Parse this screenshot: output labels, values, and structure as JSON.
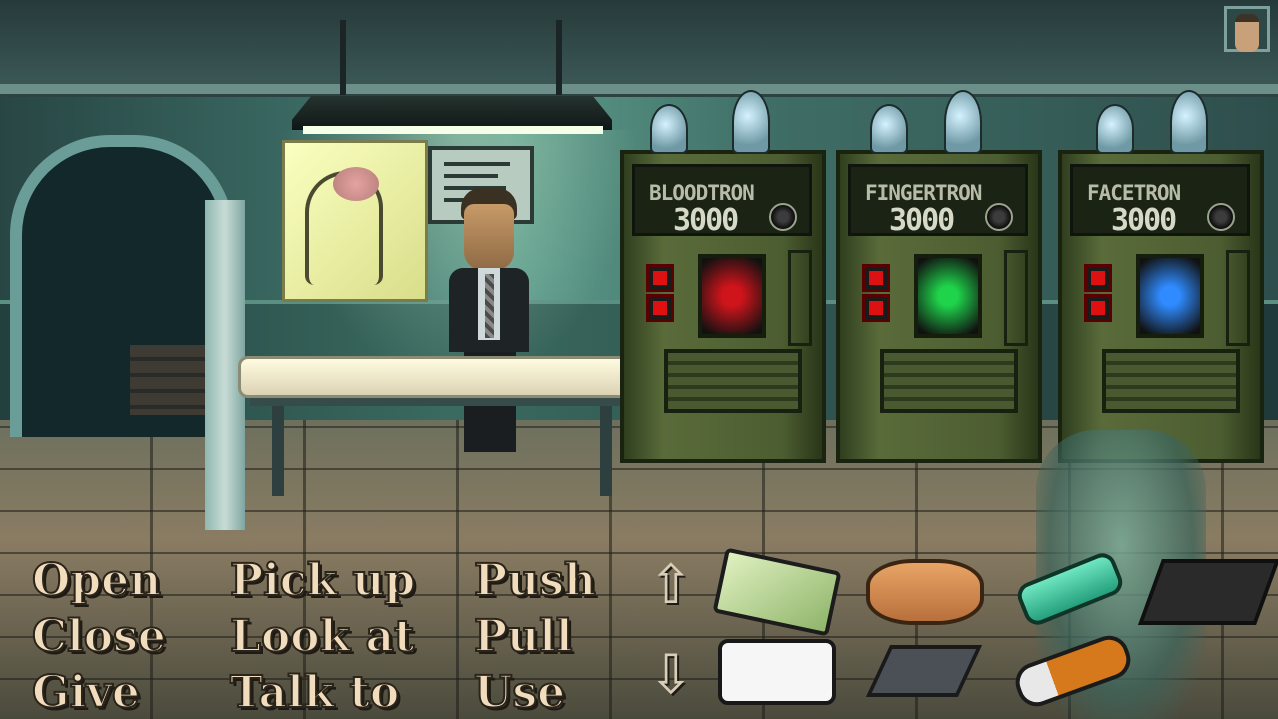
{
  "scene": {
    "machines": [
      {
        "name": "BLOODTRON",
        "number": "3000",
        "panel_color": "#d0141b"
      },
      {
        "name": "FINGERTRON",
        "number": "3000",
        "panel_color": "#1fd34a"
      },
      {
        "name": "FACETRON",
        "number": "3000",
        "panel_color": "#2f8bff"
      }
    ]
  },
  "verbs": {
    "open": "Open",
    "close": "Close",
    "give": "Give",
    "pick_up": "Pick up",
    "look_at": "Look at",
    "talk_to": "Talk to",
    "push": "Push",
    "pull": "Pull",
    "use": "Use"
  },
  "inventory": {
    "scroll_up_icon": "up-arrow-icon",
    "scroll_down_icon": "down-arrow-icon",
    "items": [
      "card-icon",
      "bread-icon",
      "vial-icon",
      "badge-icon",
      "camera-icon",
      "chip-icon",
      "batteries-icon"
    ]
  },
  "colors": {
    "verb_text": "#f1ddbd",
    "machine_green": "#4c5d31"
  }
}
